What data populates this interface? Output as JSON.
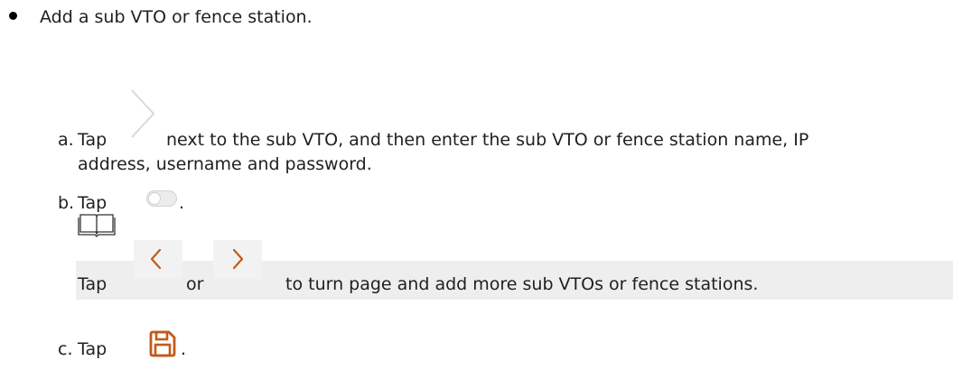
{
  "bullet": {
    "text": "Add a sub VTO or fence station."
  },
  "steps": {
    "a": {
      "marker": "a.",
      "pre": "Tap",
      "line1": "next to the sub VTO, and then enter the sub VTO or fence station name, IP",
      "line2": "address, username and password."
    },
    "b": {
      "marker": "b.",
      "pre": "Tap",
      "post": "."
    },
    "note": {
      "pre": "Tap",
      "mid": "or",
      "post": "to turn page and add more sub VTOs or fence stations."
    },
    "c": {
      "marker": "c.",
      "pre": "Tap",
      "post": "."
    }
  },
  "icons": {
    "next_arrow": "chevron-right-icon",
    "toggle": "toggle-switch-icon",
    "note": "book-note-icon",
    "prev_page": "chevron-left-icon",
    "next_page": "chevron-right-icon",
    "save": "save-icon"
  },
  "colors": {
    "accent": "#c25a1a",
    "note_bg": "#eeeeee",
    "text": "#1f1f1f"
  }
}
